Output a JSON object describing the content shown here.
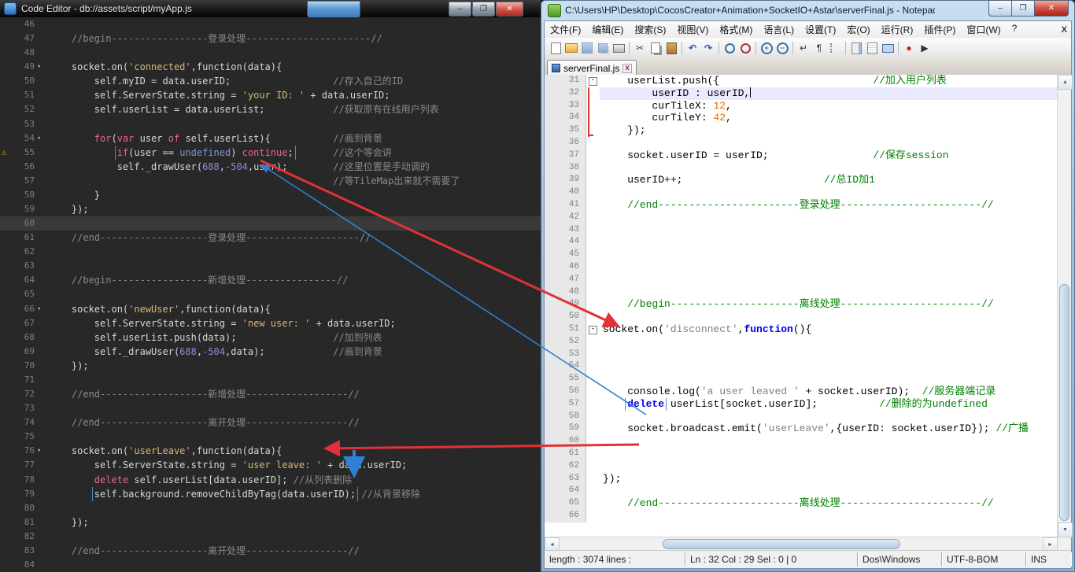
{
  "left_window": {
    "title": "Code Editor - db://assets/script/myApp.js",
    "controls": {
      "min": "–",
      "max": "❐",
      "close": "✕"
    },
    "editor": {
      "current_line": 60,
      "fold_glyph": "▾",
      "warn_glyph": "⚠",
      "lines": [
        {
          "no": 46,
          "tokens": []
        },
        {
          "no": 47,
          "tokens": [
            {
              "t": "    //begin-----------------登录处理----------------------//",
              "c": "c"
            }
          ]
        },
        {
          "no": 48,
          "tokens": []
        },
        {
          "no": 49,
          "fold": true,
          "tokens": [
            {
              "t": "    socket.on(",
              "c": "d"
            },
            {
              "t": "'connected'",
              "c": "s"
            },
            {
              "t": ",function(data){",
              "c": "d"
            }
          ]
        },
        {
          "no": 50,
          "tokens": [
            {
              "t": "        self.myID = data.userID;                  ",
              "c": "d"
            },
            {
              "t": "//存入自己的ID",
              "c": "c"
            }
          ]
        },
        {
          "no": 51,
          "tokens": [
            {
              "t": "        self.ServerState.string = ",
              "c": "d"
            },
            {
              "t": "'your ID: '",
              "c": "s"
            },
            {
              "t": " + data.userID;",
              "c": "d"
            }
          ]
        },
        {
          "no": 52,
          "tokens": [
            {
              "t": "        self.userList = data.userList;            ",
              "c": "d"
            },
            {
              "t": "//获取原有在线用户列表",
              "c": "c"
            }
          ]
        },
        {
          "no": 53,
          "tokens": []
        },
        {
          "no": 54,
          "fold": true,
          "tokens": [
            {
              "t": "        ",
              "c": "d"
            },
            {
              "t": "for",
              "c": "k"
            },
            {
              "t": "(",
              "c": "d"
            },
            {
              "t": "var",
              "c": "k"
            },
            {
              "t": " user ",
              "c": "d"
            },
            {
              "t": "of",
              "c": "k"
            },
            {
              "t": " self.userList){           ",
              "c": "d"
            },
            {
              "t": "//画到背景",
              "c": "c"
            }
          ]
        },
        {
          "no": 55,
          "warn": true,
          "tokens": [
            {
              "t": "            ",
              "c": "d"
            },
            {
              "box": [
                {
                  "t": "if",
                  "c": "k"
                },
                {
                  "t": "(user == ",
                  "c": "d"
                },
                {
                  "t": "undefined",
                  "c": "u"
                },
                {
                  "t": ") ",
                  "c": "d"
                },
                {
                  "t": "continue",
                  "c": "k"
                },
                {
                  "t": ";",
                  "c": "d"
                }
              ]
            },
            {
              "t": "       ",
              "c": "d"
            },
            {
              "t": "//这个等会讲",
              "c": "c"
            }
          ]
        },
        {
          "no": 56,
          "tokens": [
            {
              "t": "            self._drawUser(",
              "c": "d"
            },
            {
              "t": "688",
              "c": "n"
            },
            {
              "t": ",",
              "c": "d"
            },
            {
              "t": "-504",
              "c": "n"
            },
            {
              "t": ",user);        ",
              "c": "d"
            },
            {
              "t": "//这里位置是手动调的",
              "c": "c"
            }
          ]
        },
        {
          "no": 57,
          "tokens": [
            {
              "t": "                                                  ",
              "c": "d"
            },
            {
              "t": "//等TileMap出来就不需要了",
              "c": "c"
            }
          ]
        },
        {
          "no": 58,
          "tokens": [
            {
              "t": "        }",
              "c": "d"
            }
          ]
        },
        {
          "no": 59,
          "tokens": [
            {
              "t": "    });",
              "c": "d"
            }
          ]
        },
        {
          "no": 60,
          "tokens": []
        },
        {
          "no": 61,
          "tokens": [
            {
              "t": "    //end-------------------登录处理--------------------//",
              "c": "c"
            }
          ]
        },
        {
          "no": 62,
          "tokens": []
        },
        {
          "no": 63,
          "tokens": []
        },
        {
          "no": 64,
          "tokens": [
            {
              "t": "    //begin-----------------新增处理----------------//",
              "c": "c"
            }
          ]
        },
        {
          "no": 65,
          "tokens": []
        },
        {
          "no": 66,
          "fold": true,
          "tokens": [
            {
              "t": "    socket.on(",
              "c": "d"
            },
            {
              "t": "'newUser'",
              "c": "s"
            },
            {
              "t": ",function(data){",
              "c": "d"
            }
          ]
        },
        {
          "no": 67,
          "tokens": [
            {
              "t": "        self.ServerState.string = ",
              "c": "d"
            },
            {
              "t": "'new user: '",
              "c": "s"
            },
            {
              "t": " + data.userID;",
              "c": "d"
            }
          ]
        },
        {
          "no": 68,
          "tokens": [
            {
              "t": "        self.userList.push(data);                 ",
              "c": "d"
            },
            {
              "t": "//加到列表",
              "c": "c"
            }
          ]
        },
        {
          "no": 69,
          "tokens": [
            {
              "t": "        self._drawUser(",
              "c": "d"
            },
            {
              "t": "688",
              "c": "n"
            },
            {
              "t": ",",
              "c": "d"
            },
            {
              "t": "-504",
              "c": "n"
            },
            {
              "t": ",data);            ",
              "c": "d"
            },
            {
              "t": "//画到背景",
              "c": "c"
            }
          ]
        },
        {
          "no": 70,
          "tokens": [
            {
              "t": "    });",
              "c": "d"
            }
          ]
        },
        {
          "no": 71,
          "tokens": []
        },
        {
          "no": 72,
          "tokens": [
            {
              "t": "    //end-------------------新增处理------------------//",
              "c": "c"
            }
          ]
        },
        {
          "no": 73,
          "tokens": []
        },
        {
          "no": 74,
          "tokens": [
            {
              "t": "    //end-------------------离开处理------------------//",
              "c": "c"
            }
          ]
        },
        {
          "no": 75,
          "tokens": []
        },
        {
          "no": 76,
          "fold": true,
          "tokens": [
            {
              "t": "    socket.on(",
              "c": "d"
            },
            {
              "t": "'userLeave'",
              "c": "s"
            },
            {
              "t": ",function(data){",
              "c": "d"
            }
          ]
        },
        {
          "no": 77,
          "tokens": [
            {
              "t": "        self.ServerState.string = ",
              "c": "d"
            },
            {
              "t": "'user leave: '",
              "c": "s"
            },
            {
              "t": " + data.userID;",
              "c": "d"
            }
          ]
        },
        {
          "no": 78,
          "tokens": [
            {
              "t": "        ",
              "c": "d"
            },
            {
              "t": "delete",
              "c": "k"
            },
            {
              "t": " self.userList[data.userID]; ",
              "c": "d"
            },
            {
              "t": "//从列表删除",
              "c": "c"
            }
          ]
        },
        {
          "no": 79,
          "tokens": [
            {
              "t": "        ",
              "c": "d"
            },
            {
              "box": [
                {
                  "t": "self.background.removeChildByTag(data.userID);",
                  "c": "d"
                }
              ]
            },
            {
              "t": " ",
              "c": "d"
            },
            {
              "t": "//从背景移除",
              "c": "c"
            }
          ]
        },
        {
          "no": 80,
          "tokens": []
        },
        {
          "no": 81,
          "tokens": [
            {
              "t": "    });",
              "c": "d"
            }
          ]
        },
        {
          "no": 82,
          "tokens": []
        },
        {
          "no": 83,
          "tokens": [
            {
              "t": "    //end-------------------离开处理------------------//",
              "c": "c"
            }
          ]
        },
        {
          "no": 84,
          "tokens": []
        }
      ]
    }
  },
  "right_window": {
    "title": "C:\\Users\\HP\\Desktop\\CocosCreator+Animation+SocketIO+Astar\\serverFinal.js - Notepad+...",
    "controls": {
      "min": "–",
      "max": "❐",
      "close": "✕"
    },
    "menu": [
      "文件(F)",
      "编辑(E)",
      "搜索(S)",
      "视图(V)",
      "格式(M)",
      "语言(L)",
      "设置(T)",
      "宏(O)",
      "运行(R)",
      "插件(P)",
      "窗口(W)",
      "?"
    ],
    "menu_close_glyph": "X",
    "toolbar": [
      {
        "name": "new-file-icon",
        "cls": "ic-page",
        "glyph": ""
      },
      {
        "name": "open-folder-icon",
        "cls": "ic-folder",
        "glyph": ""
      },
      {
        "name": "save-icon",
        "cls": "ic-save disabled",
        "glyph": ""
      },
      {
        "name": "save-all-icon",
        "cls": "ic-saveall disabled",
        "glyph": ""
      },
      {
        "name": "print-icon",
        "cls": "ic-print",
        "glyph": ""
      },
      {
        "sep": 1
      },
      {
        "name": "cut-icon",
        "cls": "",
        "glyph": "✂"
      },
      {
        "name": "copy-icon",
        "cls": "ic-copy",
        "glyph": ""
      },
      {
        "name": "paste-icon",
        "cls": "ic-paste",
        "glyph": ""
      },
      {
        "sep": 1
      },
      {
        "name": "undo-icon",
        "cls": "blue",
        "glyph": "↶"
      },
      {
        "name": "redo-icon",
        "cls": "blue",
        "glyph": "↷"
      },
      {
        "sep": 1
      },
      {
        "name": "find-icon",
        "cls": "ic-find",
        "glyph": ""
      },
      {
        "name": "replace-icon",
        "cls": "ic-replace",
        "glyph": ""
      },
      {
        "sep": 1
      },
      {
        "name": "zoom-in-icon",
        "cls": "ic-zoom",
        "glyph": "+"
      },
      {
        "name": "zoom-out-icon",
        "cls": "ic-zoom",
        "glyph": "−"
      },
      {
        "sep": 1
      },
      {
        "name": "word-wrap-icon",
        "cls": "dark",
        "glyph": "↵"
      },
      {
        "name": "show-all-chars-icon",
        "cls": "dark",
        "glyph": "¶"
      },
      {
        "name": "indent-guide-icon",
        "cls": "ic-guide",
        "glyph": ""
      },
      {
        "sep": 1
      },
      {
        "name": "doc-map-icon",
        "cls": "ic-map",
        "glyph": ""
      },
      {
        "name": "function-list-icon",
        "cls": "ic-flist",
        "glyph": ""
      },
      {
        "name": "monitor-icon",
        "cls": "ic-monitor",
        "glyph": ""
      },
      {
        "sep": 1
      },
      {
        "name": "record-macro-icon",
        "cls": "red",
        "glyph": "●"
      },
      {
        "name": "play-macro-icon",
        "cls": "dark",
        "glyph": "▶"
      }
    ],
    "tab": {
      "label": "serverFinal.js",
      "close_glyph": "x"
    },
    "editor": {
      "current_line": 32,
      "fold_glyph": "-",
      "lines": [
        {
          "no": 31,
          "fold": true,
          "tokens": [
            {
              "t": "    userList.push({                         ",
              "c": "d"
            },
            {
              "t": "//加入用户列表",
              "c": "c"
            }
          ]
        },
        {
          "no": 32,
          "caret": true,
          "mk": true,
          "tokens": [
            {
              "t": "        userID : userID,",
              "c": "d"
            }
          ]
        },
        {
          "no": 33,
          "mk": true,
          "tokens": [
            {
              "t": "        curTileX: ",
              "c": "d"
            },
            {
              "t": "12",
              "c": "n"
            },
            {
              "t": ",",
              "c": "d"
            }
          ]
        },
        {
          "no": 34,
          "mk": true,
          "tokens": [
            {
              "t": "        curTileY: ",
              "c": "d"
            },
            {
              "t": "42",
              "c": "n"
            },
            {
              "t": ",",
              "c": "d"
            }
          ]
        },
        {
          "no": 35,
          "mk": "end",
          "tokens": [
            {
              "t": "    });",
              "c": "d"
            }
          ]
        },
        {
          "no": 36,
          "tokens": []
        },
        {
          "no": 37,
          "tokens": [
            {
              "t": "    socket.userID = userID;                 ",
              "c": "d"
            },
            {
              "t": "//保存session",
              "c": "c"
            }
          ]
        },
        {
          "no": 38,
          "tokens": []
        },
        {
          "no": 39,
          "tokens": [
            {
              "t": "    userID++;                       ",
              "c": "d"
            },
            {
              "t": "//总ID加1",
              "c": "c"
            }
          ]
        },
        {
          "no": 40,
          "tokens": []
        },
        {
          "no": 41,
          "tokens": [
            {
              "t": "    //end-----------------------登录处理-----------------------//",
              "c": "c"
            }
          ]
        },
        {
          "no": 42,
          "tokens": []
        },
        {
          "no": 43,
          "tokens": []
        },
        {
          "no": 44,
          "tokens": []
        },
        {
          "no": 45,
          "tokens": []
        },
        {
          "no": 46,
          "tokens": []
        },
        {
          "no": 47,
          "tokens": []
        },
        {
          "no": 48,
          "tokens": []
        },
        {
          "no": 49,
          "tokens": [
            {
              "t": "    //begin---------------------离线处理-----------------------//",
              "c": "c"
            }
          ]
        },
        {
          "no": 50,
          "tokens": []
        },
        {
          "no": 51,
          "fold": true,
          "tokens": [
            {
              "t": "socket.on(",
              "c": "d"
            },
            {
              "t": "'disconnect'",
              "c": "s"
            },
            {
              "t": ",",
              "c": "d"
            },
            {
              "t": "function",
              "c": "k"
            },
            {
              "t": "(){",
              "c": "d"
            }
          ]
        },
        {
          "no": 52,
          "tokens": []
        },
        {
          "no": 53,
          "tokens": []
        },
        {
          "no": 54,
          "tokens": []
        },
        {
          "no": 55,
          "tokens": []
        },
        {
          "no": 56,
          "tokens": [
            {
              "t": "    console.log(",
              "c": "d"
            },
            {
              "t": "'a user leaved '",
              "c": "s"
            },
            {
              "t": " + socket.userID);  ",
              "c": "d"
            },
            {
              "t": "//服务器端记录",
              "c": "c"
            }
          ]
        },
        {
          "no": 57,
          "tokens": [
            {
              "t": "    ",
              "c": "d"
            },
            {
              "box": [
                {
                  "t": "delete",
                  "c": "k"
                }
              ]
            },
            {
              "t": " userList[socket.userID];          ",
              "c": "d"
            },
            {
              "t": "//删除的为undefined",
              "c": "c"
            }
          ]
        },
        {
          "no": 58,
          "tokens": []
        },
        {
          "no": 59,
          "tokens": [
            {
              "t": "    socket.broadcast.emit(",
              "c": "d"
            },
            {
              "t": "'userLeave'",
              "c": "s"
            },
            {
              "t": ",{userID: socket.userID}); ",
              "c": "d"
            },
            {
              "t": "//广播",
              "c": "c"
            }
          ]
        },
        {
          "no": 60,
          "tokens": []
        },
        {
          "no": 61,
          "tokens": []
        },
        {
          "no": 62,
          "tokens": []
        },
        {
          "no": 63,
          "tokens": [
            {
              "t": "});",
              "c": "d"
            }
          ]
        },
        {
          "no": 64,
          "tokens": []
        },
        {
          "no": 65,
          "tokens": [
            {
              "t": "    //end-----------------------离线处理-----------------------//",
              "c": "c"
            }
          ]
        },
        {
          "no": 66,
          "tokens": []
        }
      ]
    },
    "scrollbar": {
      "up": "▲",
      "down": "▼",
      "left": "◄",
      "right": "►"
    },
    "status_bar": {
      "segments": [
        "length : 3074    lines :",
        "Ln : 32    Col : 29    Sel : 0 | 0",
        "Dos\\Windows",
        "UTF-8-BOM",
        "INS"
      ]
    }
  }
}
